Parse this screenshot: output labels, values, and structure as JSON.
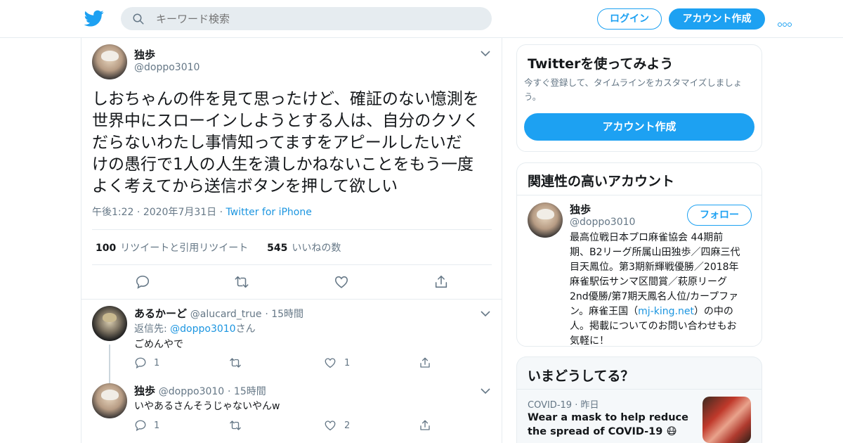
{
  "header": {
    "search_placeholder": "キーワード検索",
    "login_label": "ログイン",
    "signup_label": "アカウント作成"
  },
  "tweet": {
    "name": "独歩",
    "handle": "@doppo3010",
    "text_lines": [
      "しおちゃんの件を見て思ったけど、確証のない憶測を",
      "世界中にスローインしようとする人は、自分のクソく",
      "だらないわたし事情知ってますをアピールしたいだ",
      "けの愚行で1人の人生を潰しかねないことをもう一度",
      "よく考えてから送信ボタンを押して欲しい"
    ],
    "time": "午後1:22",
    "date": "2020年7月31日",
    "source": "Twitter for iPhone",
    "retweet_count": "100",
    "retweet_label": "リツイートと引用リツイート",
    "like_count": "545",
    "like_label": "いいねの数"
  },
  "replies": [
    {
      "name": "あるかーど",
      "handle": "@alucard_true",
      "time": "15時間",
      "reply_to_prefix": "返信先: ",
      "reply_to_handle": "@doppo3010",
      "reply_to_suffix": "さん",
      "text": "ごめんやで",
      "reply_count": "1",
      "like_count": "1"
    },
    {
      "name": "独歩",
      "handle": "@doppo3010",
      "time": "15時間",
      "text": "いやあるさんそうじゃないやんw",
      "reply_count": "1",
      "like_count": "2"
    }
  ],
  "signup_card": {
    "title": "Twitterを使ってみよう",
    "subtitle": "今すぐ登録して、タイムラインをカスタマイズしましょう。",
    "button": "アカウント作成"
  },
  "related_card": {
    "title": "関連性の高いアカウント",
    "name": "独歩",
    "handle": "@doppo3010",
    "follow_label": "フォロー",
    "bio_lines": [
      "最高位戦日本プロ麻雀協会 44期前",
      "期、B2リーグ所属山田独歩／四麻三代",
      "目天鳳位。第3期新輝戦優勝／2018年",
      "麻雀駅伝サンマ区間賞／萩原リーグ",
      "2nd優勝/第7期天鳳名人位/カープファ"
    ],
    "bio_pre_link": "ン。麻雀王国（",
    "bio_link": "mj-king.net",
    "bio_post_link": "）の中の",
    "bio_end_lines": [
      "人。掲載についてのお問い合わせもお",
      "気軽に！"
    ]
  },
  "trends_card": {
    "title": "いまどうしてる？",
    "category": "COVID-19",
    "when": "昨日",
    "text": "Wear a mask to help reduce the spread of COVID-19 😷"
  },
  "colors": {
    "accent": "#1da1f2",
    "link": "#1b95e0",
    "muted": "#657786",
    "border": "#e6ecf0"
  }
}
